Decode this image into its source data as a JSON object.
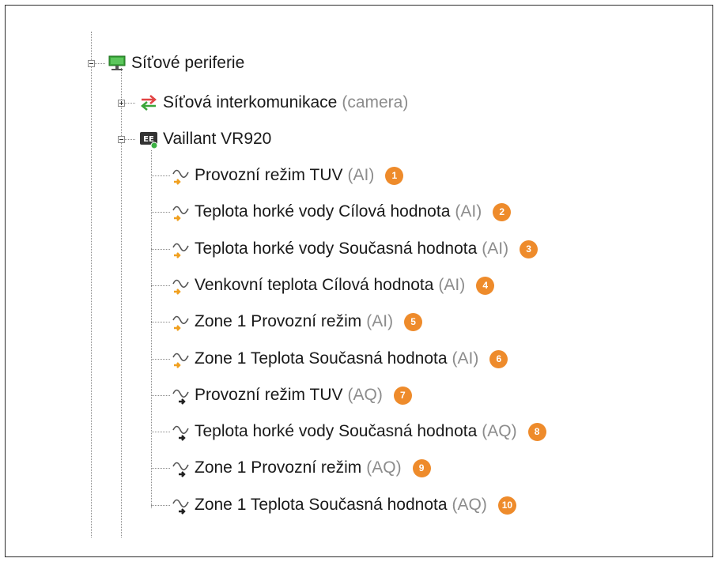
{
  "colors": {
    "badge": "#ee8b2b",
    "tag_gray": "#8c8c8c",
    "input_arrow": "#f0a020",
    "output_arrow": "#222222",
    "status_dot": "#3cb043",
    "network_green": "#3aa63a"
  },
  "tree": {
    "root": {
      "label": "Síťové periferie",
      "icon": "network-monitor-icon",
      "expanded": true
    },
    "intercom": {
      "label": "Síťová interkomunikace",
      "tag": "(camera)",
      "icon": "swap-arrows-icon",
      "expanded": false
    },
    "device": {
      "label": "Vaillant VR920",
      "icon": "device-module-icon",
      "expanded": true
    },
    "signals": [
      {
        "label": "Provozní režim TUV",
        "tag": "(AI)",
        "badge": "1",
        "icon": "analog-input-icon"
      },
      {
        "label": "Teplota horké vody Cílová hodnota",
        "tag": "(AI)",
        "badge": "2",
        "icon": "analog-input-icon"
      },
      {
        "label": "Teplota horké vody Současná hodnota",
        "tag": "(AI)",
        "badge": "3",
        "icon": "analog-input-icon"
      },
      {
        "label": "Venkovní teplota Cílová hodnota",
        "tag": "(AI)",
        "badge": "4",
        "icon": "analog-input-icon"
      },
      {
        "label": "Zone 1 Provozní režim",
        "tag": "(AI)",
        "badge": "5",
        "icon": "analog-input-icon"
      },
      {
        "label": "Zone 1 Teplota Současná hodnota",
        "tag": "(AI)",
        "badge": "6",
        "icon": "analog-input-icon"
      },
      {
        "label": "Provozní režim TUV",
        "tag": "(AQ)",
        "badge": "7",
        "icon": "analog-output-icon"
      },
      {
        "label": "Teplota horké vody Současná hodnota",
        "tag": "(AQ)",
        "badge": "8",
        "icon": "analog-output-icon"
      },
      {
        "label": "Zone 1 Provozní režim",
        "tag": "(AQ)",
        "badge": "9",
        "icon": "analog-output-icon"
      },
      {
        "label": "Zone 1 Teplota Současná hodnota",
        "tag": "(AQ)",
        "badge": "10",
        "icon": "analog-output-icon"
      }
    ]
  }
}
